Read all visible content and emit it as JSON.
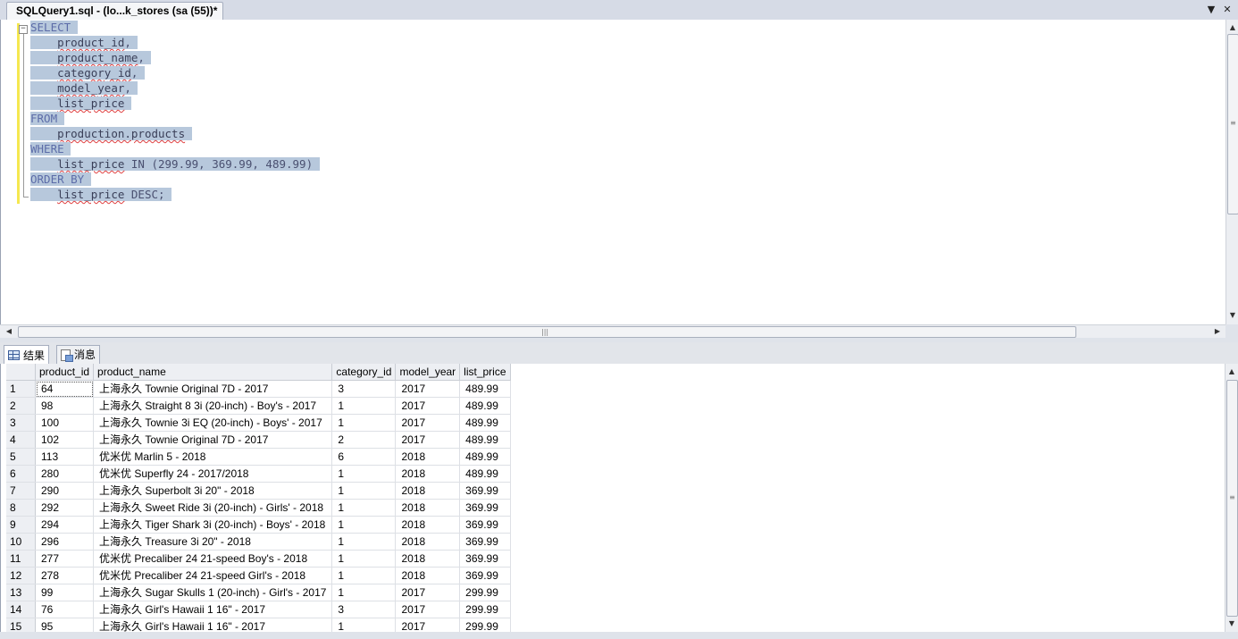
{
  "window": {
    "tab_title": "SQLQuery1.sql - (lo...k_stores (sa (55))*",
    "dropdown_glyph": "▼",
    "close_glyph": "✕"
  },
  "editor": {
    "lines": [
      [
        {
          "t": "SELECT",
          "c": "kw"
        }
      ],
      [
        {
          "t": "    "
        },
        {
          "t": "product_id",
          "c": "id"
        },
        {
          "t": ",",
          "c": "plain"
        }
      ],
      [
        {
          "t": "    "
        },
        {
          "t": "product_name",
          "c": "id"
        },
        {
          "t": ",",
          "c": "plain"
        }
      ],
      [
        {
          "t": "    "
        },
        {
          "t": "category_id",
          "c": "id"
        },
        {
          "t": ",",
          "c": "plain"
        }
      ],
      [
        {
          "t": "    "
        },
        {
          "t": "model_year",
          "c": "id"
        },
        {
          "t": ",",
          "c": "plain"
        }
      ],
      [
        {
          "t": "    "
        },
        {
          "t": "list_price",
          "c": "id"
        }
      ],
      [
        {
          "t": "FROM",
          "c": "kw"
        }
      ],
      [
        {
          "t": "    "
        },
        {
          "t": "production.products",
          "c": "id"
        }
      ],
      [
        {
          "t": "WHERE",
          "c": "kw"
        }
      ],
      [
        {
          "t": "    "
        },
        {
          "t": "list_price",
          "c": "id"
        },
        {
          "t": " IN (299.99, 369.99, 489.99)",
          "c": "plain"
        }
      ],
      [
        {
          "t": "ORDER BY",
          "c": "kw"
        }
      ],
      [
        {
          "t": "    "
        },
        {
          "t": "list_price",
          "c": "id"
        },
        {
          "t": " DESC;",
          "c": "plain"
        }
      ]
    ]
  },
  "result_tabs": {
    "results_label": "结果",
    "messages_label": "消息"
  },
  "grid": {
    "columns": [
      "",
      "product_id",
      "product_name",
      "category_id",
      "model_year",
      "list_price"
    ],
    "rows": [
      [
        "1",
        "64",
        "上海永久 Townie Original 7D - 2017",
        "3",
        "2017",
        "489.99"
      ],
      [
        "2",
        "98",
        "上海永久 Straight 8 3i (20-inch) - Boy's - 2017",
        "1",
        "2017",
        "489.99"
      ],
      [
        "3",
        "100",
        "上海永久 Townie 3i EQ (20-inch) - Boys' - 2017",
        "1",
        "2017",
        "489.99"
      ],
      [
        "4",
        "102",
        "上海永久 Townie Original 7D - 2017",
        "2",
        "2017",
        "489.99"
      ],
      [
        "5",
        "113",
        "优米优 Marlin 5 - 2018",
        "6",
        "2018",
        "489.99"
      ],
      [
        "6",
        "280",
        "优米优 Superfly 24 - 2017/2018",
        "1",
        "2018",
        "489.99"
      ],
      [
        "7",
        "290",
        "上海永久 Superbolt 3i 20\" - 2018",
        "1",
        "2018",
        "369.99"
      ],
      [
        "8",
        "292",
        "上海永久 Sweet Ride 3i (20-inch) - Girls' - 2018",
        "1",
        "2018",
        "369.99"
      ],
      [
        "9",
        "294",
        "上海永久 Tiger Shark 3i (20-inch) - Boys' - 2018",
        "1",
        "2018",
        "369.99"
      ],
      [
        "10",
        "296",
        "上海永久 Treasure 3i 20\" - 2018",
        "1",
        "2018",
        "369.99"
      ],
      [
        "11",
        "277",
        "优米优 Precaliber 24 21-speed Boy's - 2018",
        "1",
        "2018",
        "369.99"
      ],
      [
        "12",
        "278",
        "优米优 Precaliber 24 21-speed Girl's - 2018",
        "1",
        "2018",
        "369.99"
      ],
      [
        "13",
        "99",
        "上海永久 Sugar Skulls 1 (20-inch) - Girl's - 2017",
        "1",
        "2017",
        "299.99"
      ],
      [
        "14",
        "76",
        "上海永久 Girl's Hawaii 1 16\" - 2017",
        "3",
        "2017",
        "299.99"
      ],
      [
        "15",
        "95",
        "上海永久 Girl's Hawaii 1 16\" - 2017",
        "1",
        "2017",
        "299.99"
      ]
    ]
  }
}
